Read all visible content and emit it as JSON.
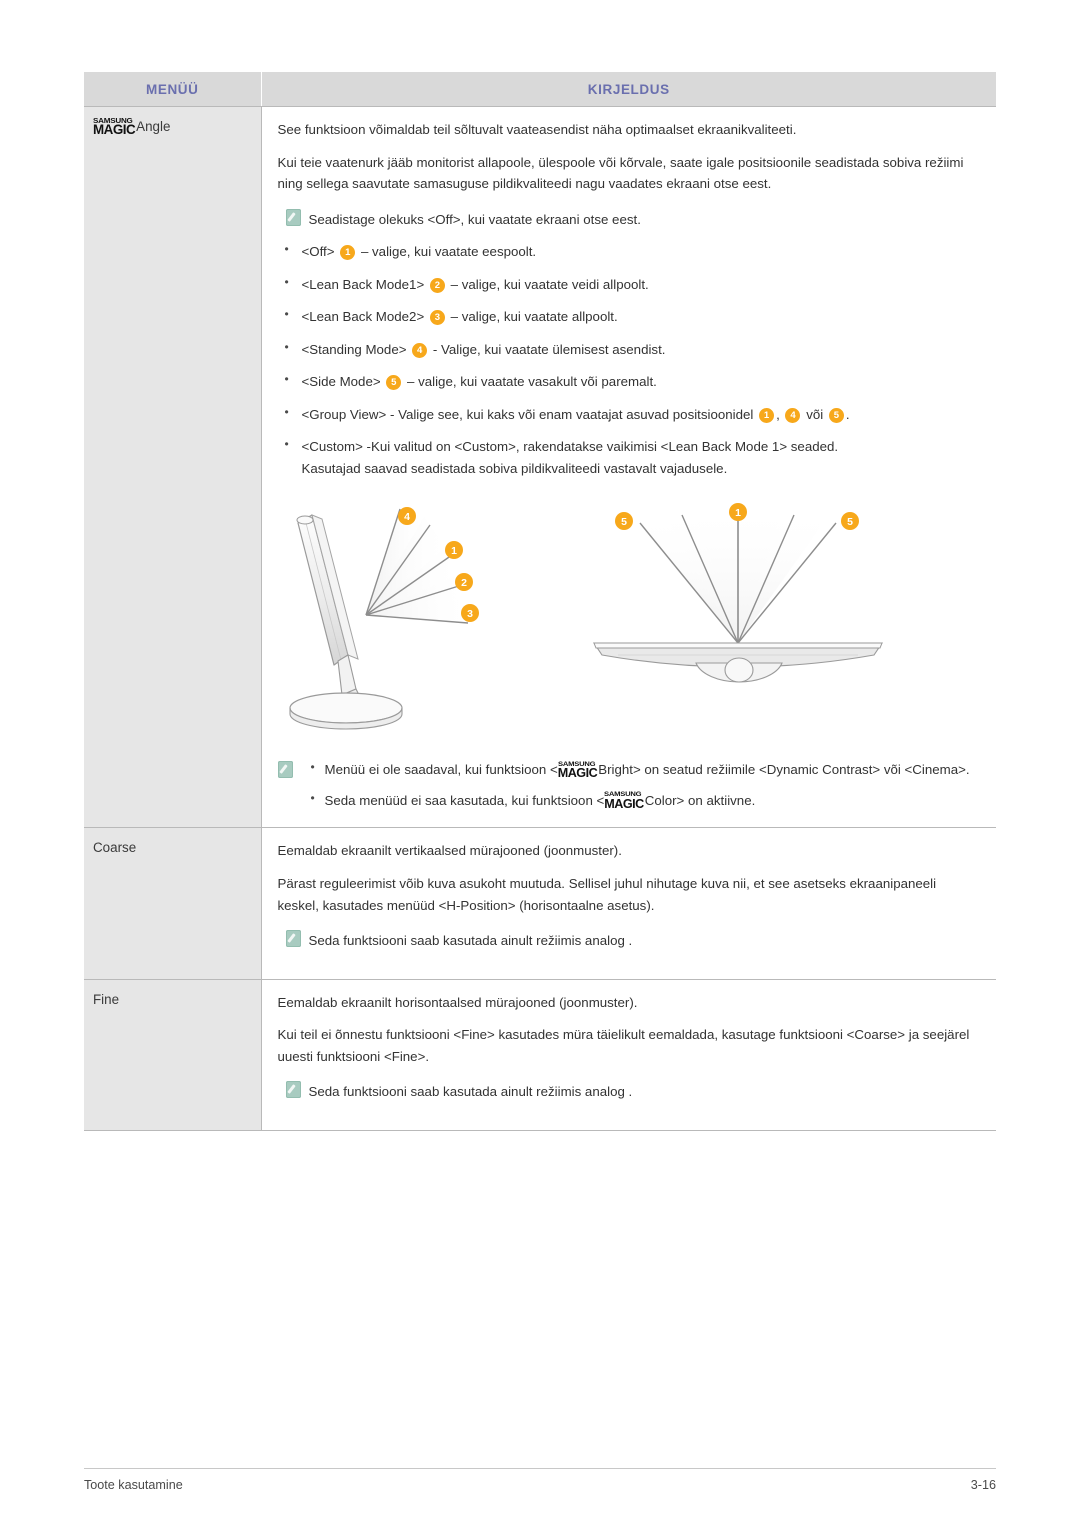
{
  "table": {
    "headers": {
      "menu": "MENÜÜ",
      "description": "KIRJELDUS"
    },
    "header_color": "#6a6fae",
    "header_bg": "#d9d9d9",
    "menu_col_bg": "#e6e6e6"
  },
  "rows": [
    {
      "menu": {
        "logo_top": "SAMSUNG",
        "logo_bottom": "MAGIC",
        "label": "Angle"
      },
      "desc": {
        "p1": "See funktsioon võimaldab teil sõltuvalt vaateasendist näha optimaalset ekraanikvaliteeti.",
        "p2": "Kui teie vaatenurk jääb monitorist allapoole, ülespoole või kõrvale, saate igale positsioonile seadistada sobiva režiimi ning sellega saavutate samasuguse pildikvaliteedi nagu vaadates ekraani otse eest.",
        "note1": "Seadistage olekuks <Off>, kui vaatate ekraani otse eest.",
        "bullets": [
          {
            "pre": "<Off>",
            "badge": "1",
            "post": "– valige, kui vaatate eespoolt."
          },
          {
            "pre": "<Lean Back Mode1>",
            "badge": "2",
            "post": "– valige, kui vaatate veidi allpoolt."
          },
          {
            "pre": "<Lean Back Mode2>",
            "badge": "3",
            "post": "– valige, kui vaatate allpoolt."
          },
          {
            "pre": "<Standing Mode>",
            "badge": "4",
            "post": "- Valige, kui vaatate ülemisest asendist."
          },
          {
            "pre": "<Side Mode>",
            "badge": "5",
            "post": "– valige, kui vaatate vasakult või paremalt."
          }
        ],
        "group_view": {
          "pre": "<Group View> - Valige see, kui kaks või enam vaatajat asuvad positsioonidel",
          "badge_a": "1",
          "sep": ",",
          "badge_b": "4",
          "mid": "või",
          "badge_c": "5",
          "end": "."
        },
        "custom": {
          "line1": "<Custom> -Kui valitud on <Custom>, rakendatakse vaikimisi <Lean Back Mode 1> seaded.",
          "line2": "Kasutajad saavad seadistada sobiva pildikvaliteedi vastavalt vajadusele."
        },
        "footnotes": [
          {
            "part1": "Menüü ei ole saadaval, kui funktsioon <",
            "logo_top": "SAMSUNG",
            "logo_bottom": "MAGIC",
            "part2": "Bright> on seatud režiimile <Dynamic Contrast> või <Cinema>."
          },
          {
            "part1": "Seda menüüd ei saa kasutada, kui funktsioon <",
            "logo_top": "SAMSUNG",
            "logo_bottom": "MAGIC",
            "part2": "Color> on aktiivne."
          }
        ]
      }
    },
    {
      "menu": {
        "label": "Coarse"
      },
      "desc": {
        "p1": "Eemaldab ekraanilt vertikaalsed mürajooned (joonmuster).",
        "p2": "Pärast reguleerimist võib kuva asukoht muutuda. Sellisel juhul nihutage kuva nii, et see asetseks ekraanipaneeli keskel, kasutades menüüd <H-Position> (horisontaalne asetus).",
        "note1": "Seda funktsiooni saab kasutada ainult režiimis analog ."
      }
    },
    {
      "menu": {
        "label": "Fine"
      },
      "desc": {
        "p1": "Eemaldab ekraanilt horisontaalsed mürajooned (joonmuster).",
        "p2": "Kui teil ei õnnestu funktsiooni <Fine> kasutades müra täielikult eemaldada, kasutage funktsiooni <Coarse> ja seejärel uuesti funktsiooni <Fine>.",
        "note1": "Seda funktsiooni saab kasutada ainult režiimis analog ."
      }
    }
  ],
  "diagram": {
    "side_view": {
      "badges": [
        "4",
        "1",
        "2",
        "3"
      ]
    },
    "top_view": {
      "badges": [
        "5",
        "1",
        "5"
      ]
    },
    "badge_color": "#f7a81b"
  },
  "footer": {
    "left": "Toote kasutamine",
    "right": "3-16"
  }
}
